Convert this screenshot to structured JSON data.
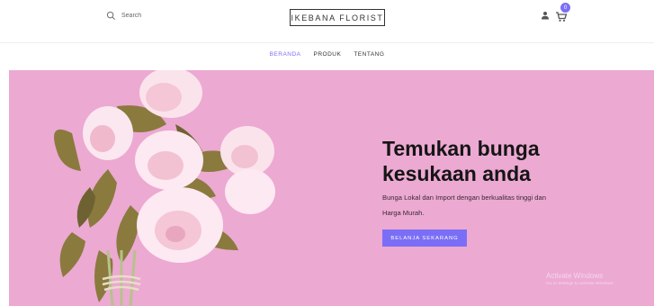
{
  "header": {
    "search": {
      "placeholder": "Search",
      "icon": "search-icon"
    },
    "logo": "IKEBANA FLORIST",
    "user_icon": "user-icon",
    "cart": {
      "icon": "cart-icon",
      "count": "0"
    }
  },
  "nav": {
    "items": [
      {
        "label": "BERANDA",
        "active": true
      },
      {
        "label": "PRODUK",
        "active": false
      },
      {
        "label": "TENTANG",
        "active": false
      }
    ]
  },
  "hero": {
    "title_line1": "Temukan bunga",
    "title_line2": "kesukaan anda",
    "subtitle_line1": "Bunga Lokal dan Import dengan berkualitas tinggi dan",
    "subtitle_line2": "Harga Murah.",
    "cta_label": "BELANJA SEKARANG"
  },
  "watermark": {
    "title": "Activate Windows",
    "subtitle": "Go to Settings to activate Windows."
  },
  "colors": {
    "accent": "#7b6ef6",
    "hero_bg": "#eca9d2",
    "peony": "#fde9f1",
    "leaf": "#8a7a3e"
  }
}
